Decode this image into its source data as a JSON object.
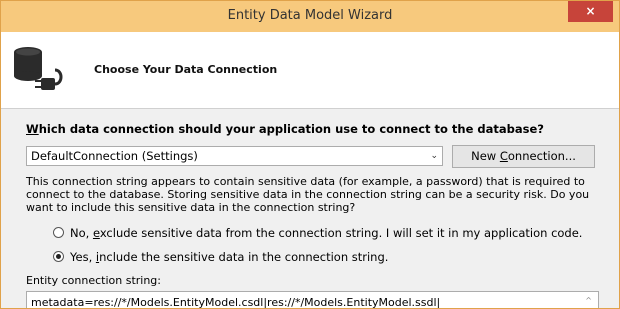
{
  "window": {
    "title": "Entity Data Model Wizard",
    "close_icon": "×"
  },
  "header": {
    "icon": "database-plug-icon",
    "title": "Choose Your Data Connection"
  },
  "question": {
    "prefix": "W",
    "rest": "hich data connection should your application use to connect to the database?"
  },
  "connection_select": {
    "value": "DefaultConnection (Settings)",
    "arrow": "⌄"
  },
  "new_connection_button": {
    "prefix": "New ",
    "underlined": "C",
    "rest": "onnection..."
  },
  "description": "This connection string appears to contain sensitive data (for example, a password) that is required to connect to the database. Storing sensitive data in the connection string can be a security risk. Do you want to include this sensitive data in the connection string?",
  "options": [
    {
      "pre": "No, ",
      "underlined": "e",
      "rest": "xclude sensitive data from the connection string. I will set it in my application code.",
      "selected": false
    },
    {
      "pre": "Yes, ",
      "underlined": "i",
      "rest": "nclude the sensitive data in the connection string.",
      "selected": true
    }
  ],
  "entity_connection": {
    "label": "Entity connection string:",
    "value": "metadata=res://*/Models.EntityModel.csdl|res://*/Models.EntityModel.ssdl|",
    "scroll_arrow": "^"
  }
}
